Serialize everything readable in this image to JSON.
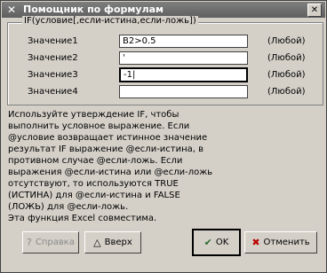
{
  "window": {
    "title": "Помощник по формулам"
  },
  "group": {
    "title": "IF(условие[,если-истина,если-ложь])",
    "rows": [
      {
        "label": "Значение1",
        "value": "B2>0.5",
        "hint": "(Любой)"
      },
      {
        "label": "Значение2",
        "value": "'",
        "hint": "(Любой)"
      },
      {
        "label": "Значение3",
        "value": "-1|",
        "hint": "(Любой)"
      },
      {
        "label": "Значение4",
        "value": "",
        "hint": "(Любой)"
      }
    ]
  },
  "help_text": "Используйте утверждение IF, чтобы\nвыполнить условное выражение. Если\n@условие возвращает истинное значение\nрезультат IF выражение @если-истина, в\nпротивном случае @если-ложь. Если\nвыражения @если-истина или @если-ложь\nотсутствуют, то используются TRUE\n(ИСТИНА) для @если-истина и FALSE\n(ЛОЖЬ) для @если-ложь.\nЭта функция Excel совместима.",
  "buttons": {
    "help": "Справка",
    "up": "Вверх",
    "ok": "OK",
    "cancel": "Отменить"
  },
  "icons": {
    "app": "x-app-icon",
    "close": "close-icon",
    "help": "question-icon",
    "up": "triangle-up-icon",
    "ok": "checkmark-icon",
    "cancel": "cross-icon"
  }
}
